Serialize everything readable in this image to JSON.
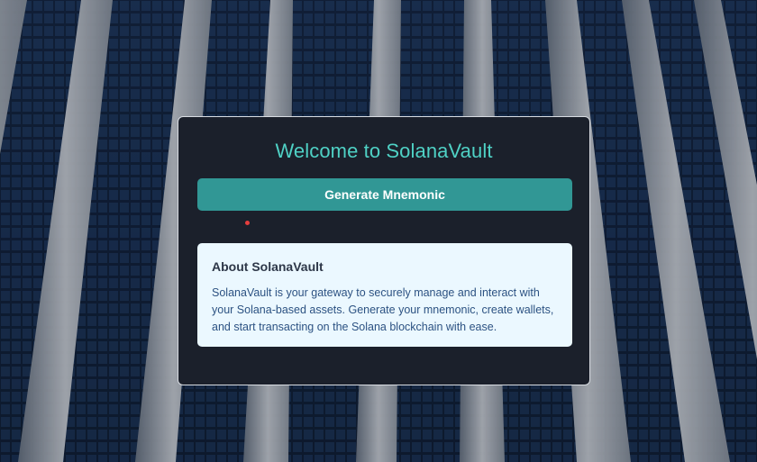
{
  "welcome": {
    "title": "Welcome to SolanaVault",
    "generate_label": "Generate Mnemonic"
  },
  "about": {
    "heading": "About SolanaVault",
    "body": "SolanaVault is your gateway to securely manage and interact with your Solana-based assets. Generate your mnemonic, create wallets, and start transacting on the Solana blockchain with ease."
  },
  "colors": {
    "accent": "#4fd1c5",
    "button": "#319795",
    "card": "#1b202b",
    "about_bg": "#ebf8ff",
    "indicator": "#e53e3e"
  }
}
